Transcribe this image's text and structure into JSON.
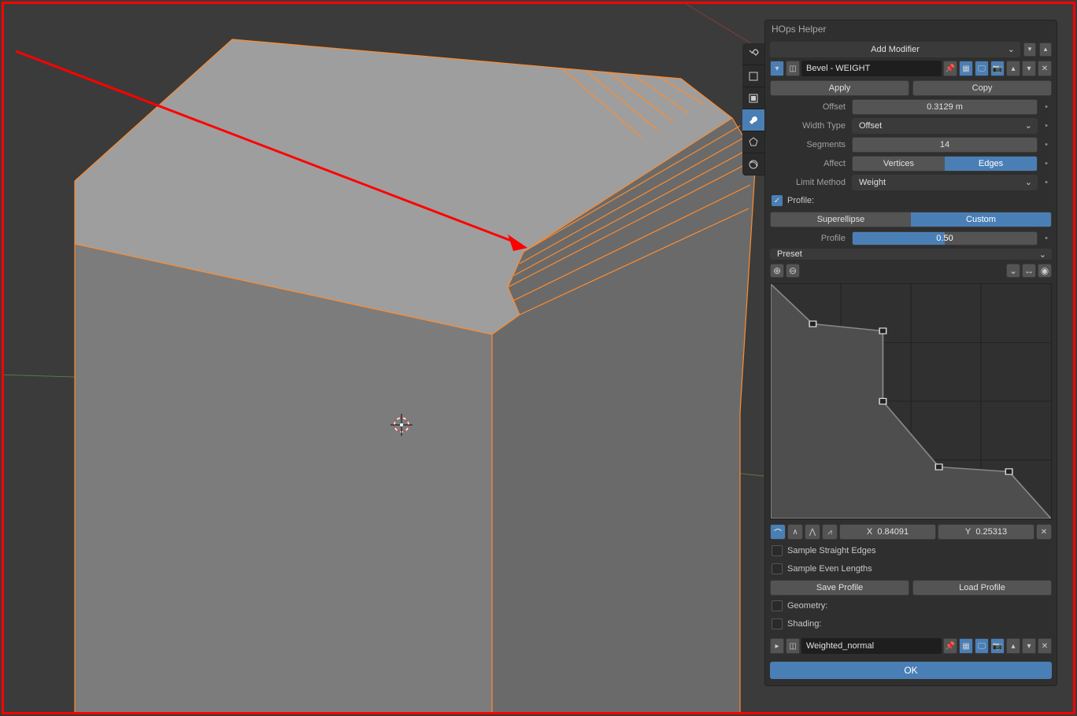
{
  "panel": {
    "title": "HOps Helper",
    "add_modifier": "Add Modifier",
    "modifier": {
      "name": "Bevel - WEIGHT",
      "apply": "Apply",
      "copy": "Copy"
    },
    "offset": {
      "label": "Offset",
      "value": "0.3129 m"
    },
    "width_type": {
      "label": "Width Type",
      "value": "Offset"
    },
    "segments": {
      "label": "Segments",
      "value": "14"
    },
    "affect": {
      "label": "Affect",
      "opts": [
        "Vertices",
        "Edges"
      ],
      "active": 1
    },
    "limit": {
      "label": "Limit Method",
      "value": "Weight"
    },
    "profile_chk": "Profile:",
    "profile_tabs": {
      "opts": [
        "Superellipse",
        "Custom"
      ],
      "active": 1
    },
    "profile": {
      "label": "Profile",
      "value": "0.50",
      "fill": 0.5
    },
    "preset": "Preset",
    "xy": {
      "x_lbl": "X",
      "x": "0.84091",
      "y_lbl": "Y",
      "y": "0.25313"
    },
    "sample_straight": "Sample Straight Edges",
    "sample_even": "Sample Even Lengths",
    "save_profile": "Save Profile",
    "load_profile": "Load Profile",
    "geometry": "Geometry:",
    "shading": "Shading:",
    "wn": {
      "name": "Weighted_normal"
    },
    "ok": "OK"
  },
  "curve_points": [
    {
      "x": 0.0,
      "y": 1.0
    },
    {
      "x": 0.15,
      "y": 0.83
    },
    {
      "x": 0.4,
      "y": 0.8
    },
    {
      "x": 0.4,
      "y": 0.5
    },
    {
      "x": 0.6,
      "y": 0.22
    },
    {
      "x": 0.85,
      "y": 0.2
    },
    {
      "x": 1.0,
      "y": 0.0
    }
  ]
}
